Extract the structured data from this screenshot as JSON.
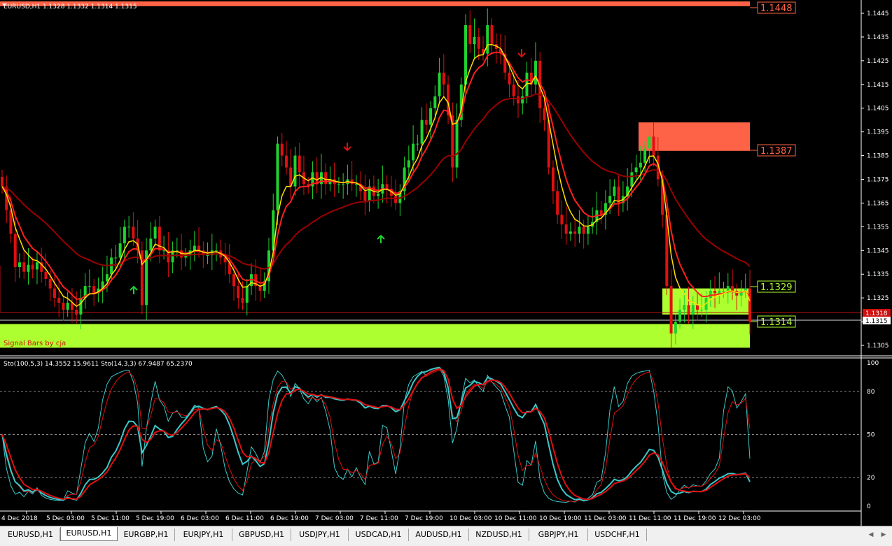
{
  "window": {
    "main_title": "EURUSD,H1  1.1328 1.1332 1.1314 1.1315",
    "signal_label": "Signal Bars by cja",
    "stoch_title": "Sto(100,5,3) 14.3552 15.9611  Sto(14,3,3) 67.9487 65.2370",
    "price_tag_red": "1.1318",
    "price_tag_current": "1.1315"
  },
  "price_axis": [
    "1.1445",
    "1.1435",
    "1.1425",
    "1.1415",
    "1.1405",
    "1.1395",
    "1.1385",
    "1.1375",
    "1.1365",
    "1.1355",
    "1.1345",
    "1.1335",
    "1.1325",
    "1.1315",
    "1.1305"
  ],
  "stoch_axis": [
    "100",
    "80",
    "50",
    "20",
    "0"
  ],
  "time_axis": [
    "4 Dec 2018",
    "5 Dec 03:00",
    "5 Dec 11:00",
    "5 Dec 19:00",
    "6 Dec 03:00",
    "6 Dec 11:00",
    "6 Dec 19:00",
    "7 Dec 03:00",
    "7 Dec 11:00",
    "7 Dec 19:00",
    "10 Dec 03:00",
    "10 Dec 11:00",
    "10 Dec 19:00",
    "11 Dec 03:00",
    "11 Dec 11:00",
    "11 Dec 19:00",
    "12 Dec 03:00"
  ],
  "zones": [
    {
      "label": "1.1448",
      "top": 1.145,
      "bottom": 1.1448,
      "color": "#ff6347"
    },
    {
      "label": "1.1387",
      "top": 1.1399,
      "bottom": 1.1387,
      "color": "#ff6347"
    },
    {
      "label": "1.1329",
      "top": 1.1329,
      "bottom": 1.1318,
      "color": "#adff2f"
    },
    {
      "label": "1.1314",
      "top": 1.1314,
      "bottom": 1.1304,
      "color": "#adff2f"
    }
  ],
  "colors": {
    "bull": "#1fd32f",
    "bear": "#e01010",
    "ma_fast": "#ffe000",
    "ma_mid": "#ff2020",
    "ma_slow": "#9b0000",
    "stoch_main": "#3cc8c8",
    "stoch_signal": "#e01010"
  },
  "tabs": [
    "EURUSD,H1",
    "EURUSD,H1",
    "EURGBP,H1",
    "EURJPY,H1",
    "GBPUSD,H1",
    "USDJPY,H1",
    "USDCAD,H1",
    "AUDUSD,H1",
    "NZDUSD,H1",
    "GBPJPY,H1",
    "USDCHF,H1"
  ],
  "active_tab": 1,
  "chart_data": {
    "type": "candlestick",
    "price_range": [
      1.1302,
      1.145
    ],
    "closes": [
      1.1372,
      1.1362,
      1.1352,
      1.1338,
      1.134,
      1.1336,
      1.1339,
      1.1337,
      1.134,
      1.1336,
      1.1333,
      1.1329,
      1.1325,
      1.1323,
      1.132,
      1.1323,
      1.132,
      1.1318,
      1.1325,
      1.133,
      1.133,
      1.1327,
      1.1329,
      1.1332,
      1.1335,
      1.1342,
      1.1342,
      1.1348,
      1.1355,
      1.1355,
      1.135,
      1.1345,
      1.1322,
      1.1345,
      1.135,
      1.1355,
      1.1345,
      1.1345,
      1.134,
      1.1345,
      1.1345,
      1.1342,
      1.1343,
      1.1345,
      1.1347,
      1.1345,
      1.1343,
      1.1343,
      1.1345,
      1.1345,
      1.1342,
      1.134,
      1.1335,
      1.133,
      1.1325,
      1.1323,
      1.133,
      1.1335,
      1.133,
      1.1328,
      1.1332,
      1.1345,
      1.1362,
      1.139,
      1.1385,
      1.138,
      1.1372,
      1.1385,
      1.1378,
      1.1373,
      1.1372,
      1.1378,
      1.1373,
      1.1378,
      1.1373,
      1.1375,
      1.1373,
      1.1373,
      1.1373,
      1.1375,
      1.1373,
      1.1373,
      1.137,
      1.1366,
      1.1372,
      1.1368,
      1.1369,
      1.1373,
      1.1371,
      1.1368,
      1.1365,
      1.137,
      1.138,
      1.1383,
      1.139,
      1.139,
      1.14,
      1.1398,
      1.1405,
      1.141,
      1.142,
      1.1415,
      1.1402,
      1.138,
      1.14,
      1.1415,
      1.144,
      1.1432,
      1.1435,
      1.143,
      1.1428,
      1.144,
      1.1432,
      1.143,
      1.1428,
      1.142,
      1.1415,
      1.141,
      1.1407,
      1.141,
      1.142,
      1.1415,
      1.1425,
      1.1405,
      1.14,
      1.138,
      1.137,
      1.136,
      1.1356,
      1.1352,
      1.1353,
      1.1352,
      1.1355,
      1.1352,
      1.1355,
      1.1357,
      1.1362,
      1.136,
      1.1365,
      1.1368,
      1.1372,
      1.1365,
      1.1368,
      1.1372,
      1.1378,
      1.138,
      1.1382,
      1.1388,
      1.1393,
      1.1385,
      1.1375,
      1.136,
      1.133,
      1.131,
      1.1315,
      1.132,
      1.1322,
      1.1318,
      1.1322,
      1.132,
      1.132,
      1.1325,
      1.1328,
      1.1327,
      1.1328,
      1.1328,
      1.133,
      1.1328,
      1.1326,
      1.1328,
      1.1329,
      1.1315
    ]
  }
}
